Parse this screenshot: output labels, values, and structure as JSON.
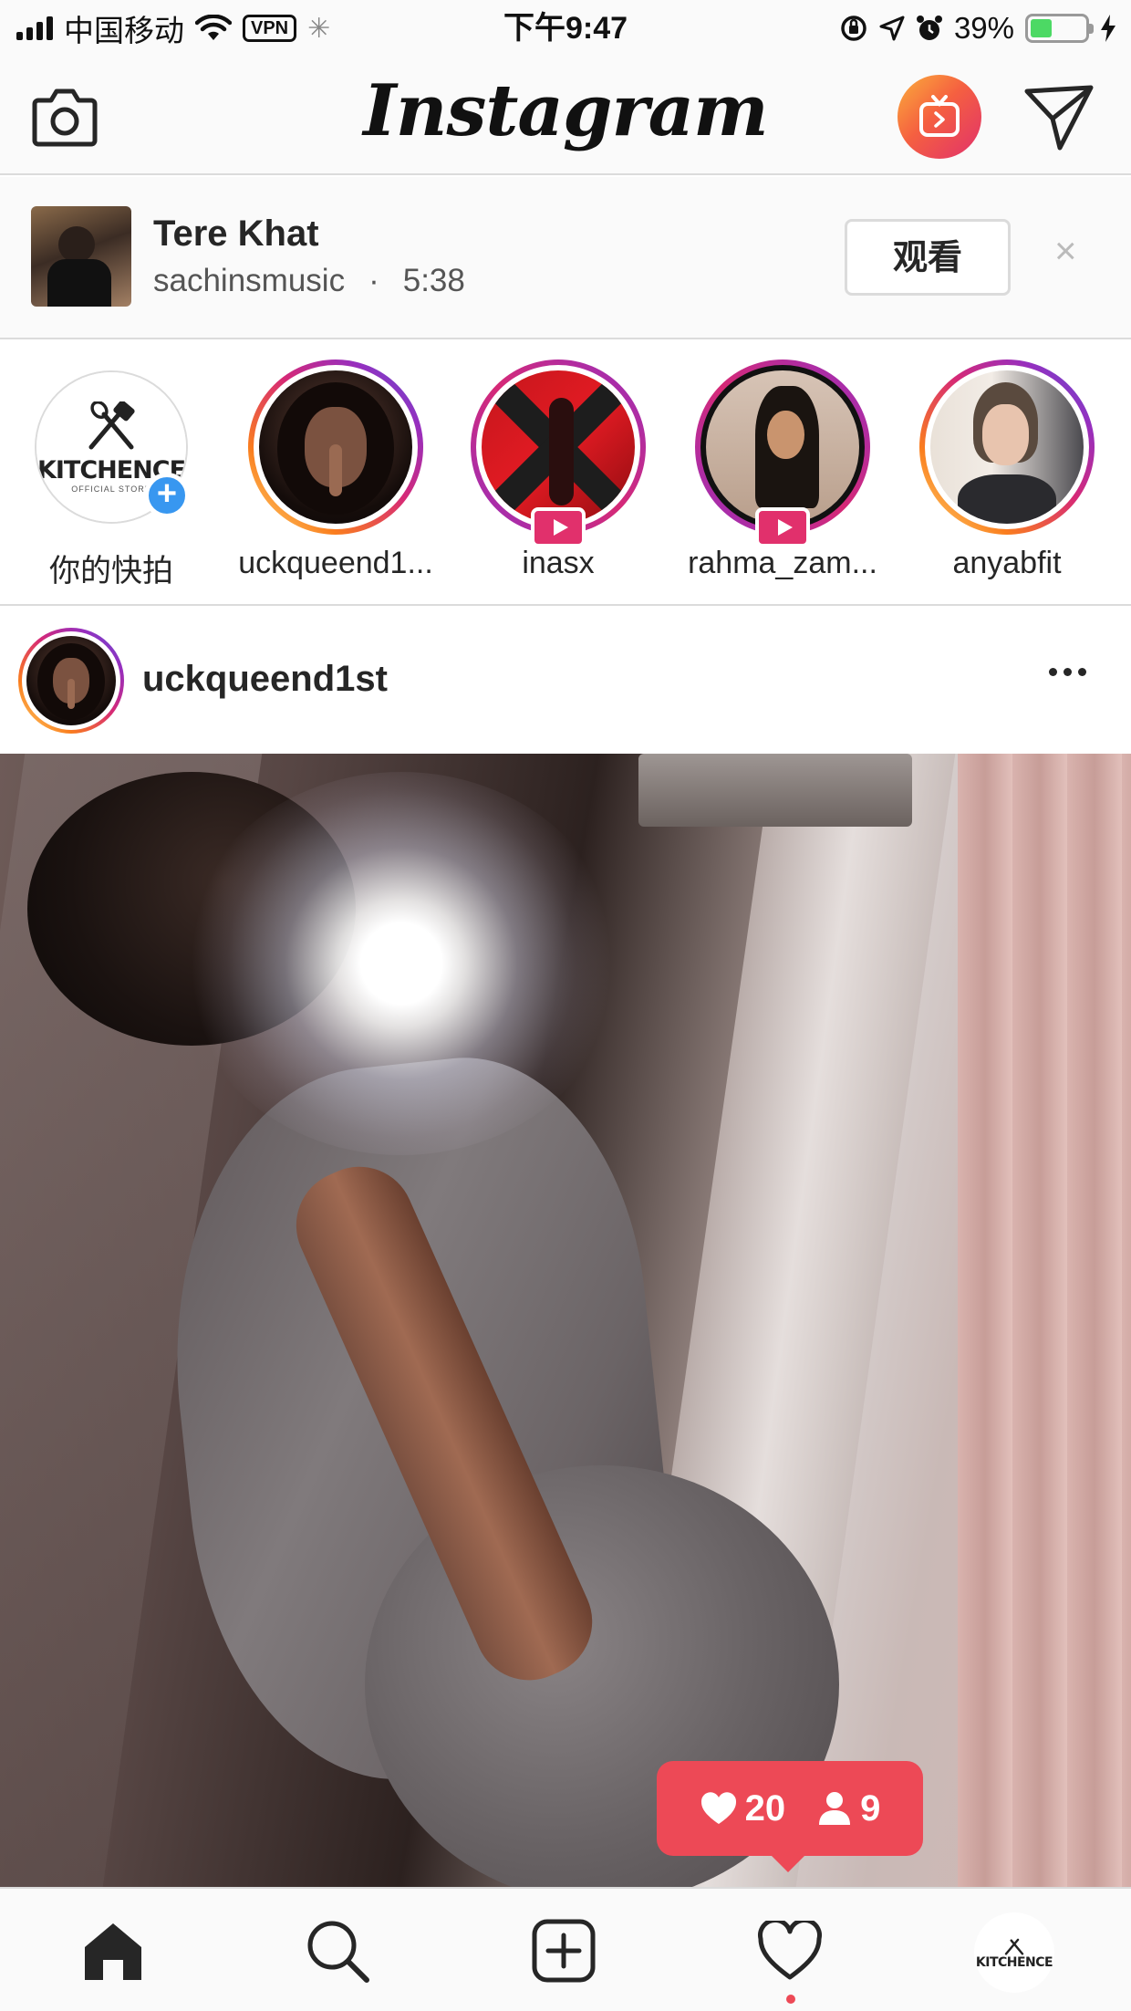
{
  "status_bar": {
    "carrier": "中国移动",
    "vpn": "VPN",
    "time": "下午9:47",
    "battery": "39%",
    "battery_level": 0.39
  },
  "header": {
    "logo": "Instagram",
    "igtv_icon": "igtv-icon",
    "camera_icon": "camera-icon",
    "direct_icon": "paper-plane-icon"
  },
  "igtv": {
    "title": "Tere Khat",
    "channel": "sachinsmusic",
    "separator": "·",
    "duration": "5:38",
    "watch_label": "观看",
    "close": "×"
  },
  "stories": [
    {
      "label": "你的快拍",
      "brand": "KITCHENCE",
      "brand_sub": "OFFICIAL STORE",
      "own": true
    },
    {
      "label": "uckqueend1..."
    },
    {
      "label": "inasx",
      "live": true
    },
    {
      "label": "rahma_zam...",
      "live": true
    },
    {
      "label": "anyabfit"
    }
  ],
  "post": {
    "username": "uckqueend1st"
  },
  "activity": {
    "likes": "20",
    "follows": "9",
    "like_icon": "heart-icon",
    "follow_icon": "person-icon"
  },
  "tabbar": {
    "home": "home-icon",
    "search": "search-icon",
    "new_post": "add-post-icon",
    "activity": "heart-icon",
    "profile_brand": "KITCHENCE"
  },
  "colors": {
    "accent_red": "#ed4956",
    "link_blue": "#3897f0",
    "live_pink": "#e1306c"
  }
}
